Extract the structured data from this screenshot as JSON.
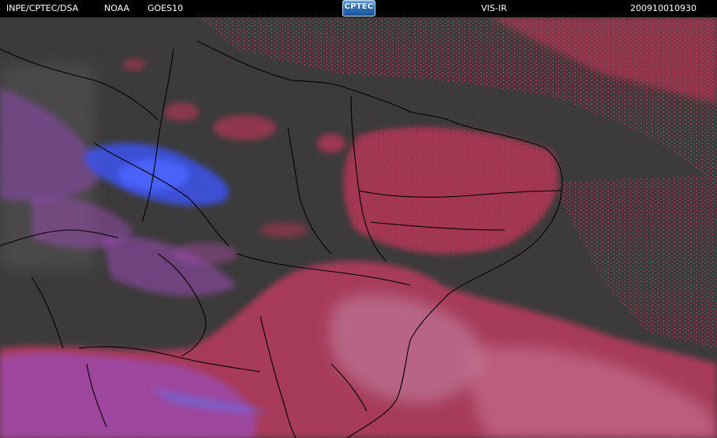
{
  "header": {
    "agency": "INPE/CPTEC/DSA",
    "noaa": "NOAA",
    "satellite": "GOES10",
    "logo_text": "CPTEC",
    "channel": "VIS-IR",
    "timestamp": "200910010930"
  },
  "colors": {
    "background": "#3a3a3a",
    "warm_cloud": "#c8345a",
    "cold_cloud": "#3a52f0",
    "mixed_cloud": "#9a4cb4",
    "borders": "#000000",
    "header_text": "#ffffff",
    "logo": "#2b6fb8"
  },
  "icons": {
    "logo": "cptec-logo-icon"
  }
}
